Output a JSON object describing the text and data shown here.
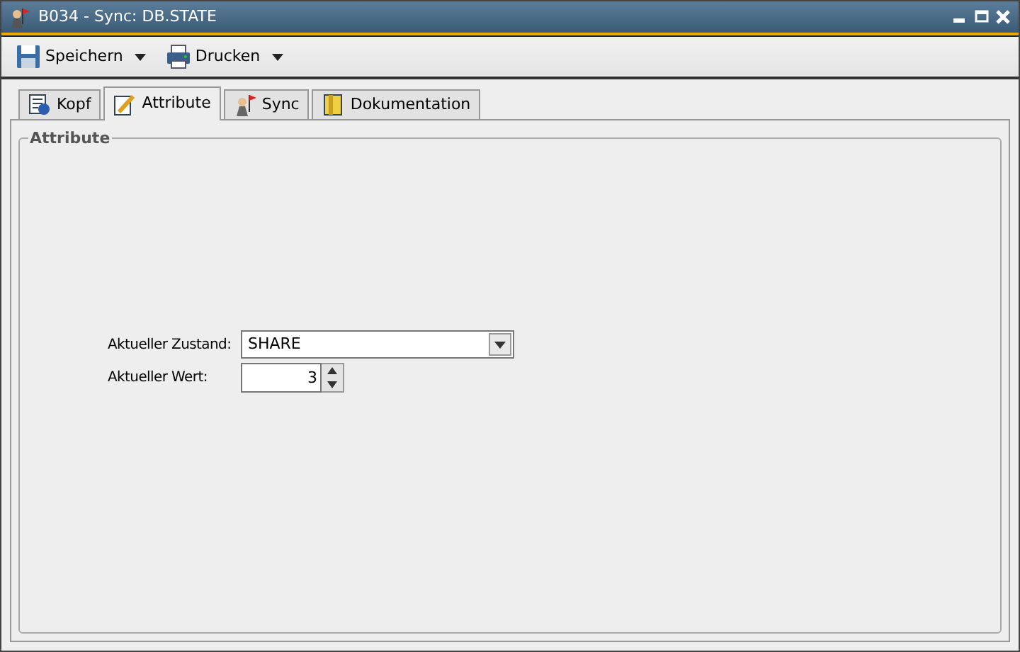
{
  "window": {
    "title": "B034 - Sync: DB.STATE"
  },
  "toolbar": [
    {
      "label": "Speichern",
      "kind": "save"
    },
    {
      "label": "Drucken",
      "kind": "print"
    }
  ],
  "tabs": [
    {
      "label": "Kopf",
      "kind": "info",
      "selected": false
    },
    {
      "label": "Attribute",
      "kind": "edit",
      "selected": true
    },
    {
      "label": "Sync",
      "kind": "sync",
      "selected": false
    },
    {
      "label": "Dokumentation",
      "kind": "doc",
      "selected": false
    }
  ],
  "group": {
    "title": "Attribute"
  },
  "fields": [
    {
      "label": "Aktueller Zustand:",
      "kind": "combo",
      "value": "SHARE"
    },
    {
      "label": "Aktueller Wert:",
      "kind": "spinner",
      "value": "3"
    }
  ]
}
